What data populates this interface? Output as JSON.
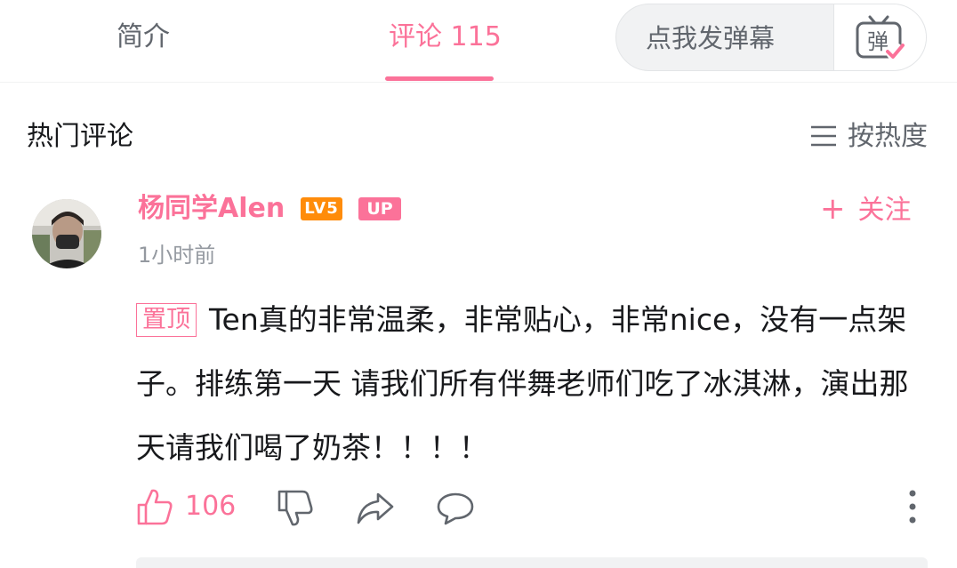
{
  "tabs": {
    "intro_label": "简介",
    "comments_label": "评论 115"
  },
  "danmaku": {
    "placeholder": "点我发弹幕",
    "icon_label": "弹"
  },
  "comments_section": {
    "title": "热门评论",
    "sort_label": "按热度"
  },
  "comment": {
    "username": "杨同学Alen",
    "level_badge": "LV5",
    "up_badge": "UP",
    "follow_label": "关注",
    "time": "1小时前",
    "pinned_tag": "置顶",
    "text": "Ten真的非常温柔，非常贴心，非常nice，没有一点架子。排练第一天 请我们所有伴舞老师们吃了冰淇淋，演出那天请我们喝了奶茶！！！！",
    "like_count": "106"
  },
  "colors": {
    "accent": "#fb7299",
    "level": "#ff8c0a",
    "secondary_text": "#9499a0",
    "icon_gray": "#61666d"
  }
}
